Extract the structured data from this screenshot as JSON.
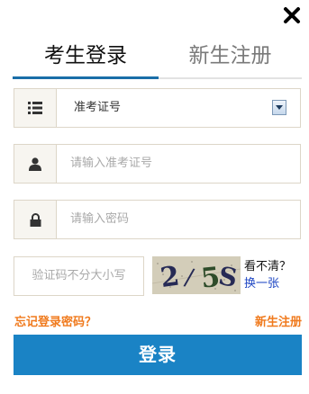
{
  "tabs": [
    {
      "label": "考生登录",
      "active": true
    },
    {
      "label": "新生注册",
      "active": false
    }
  ],
  "form": {
    "id_type": {
      "value": "准考证号",
      "icon": "list-icon"
    },
    "account": {
      "placeholder": "请输入准考证号",
      "icon": "user-icon"
    },
    "password": {
      "placeholder": "请输入密码",
      "icon": "lock-icon"
    },
    "captcha": {
      "placeholder": "验证码不分大小写",
      "image_text": "2/5S",
      "help_text": "看不清？",
      "refresh_label": "换一张"
    }
  },
  "links": {
    "forgot": "忘记登录密码？",
    "register": "新生注册"
  },
  "login_button": "登录",
  "colors": {
    "accent": "#1a83c5",
    "link": "#f07a1d",
    "border": "#ddd6c8"
  }
}
